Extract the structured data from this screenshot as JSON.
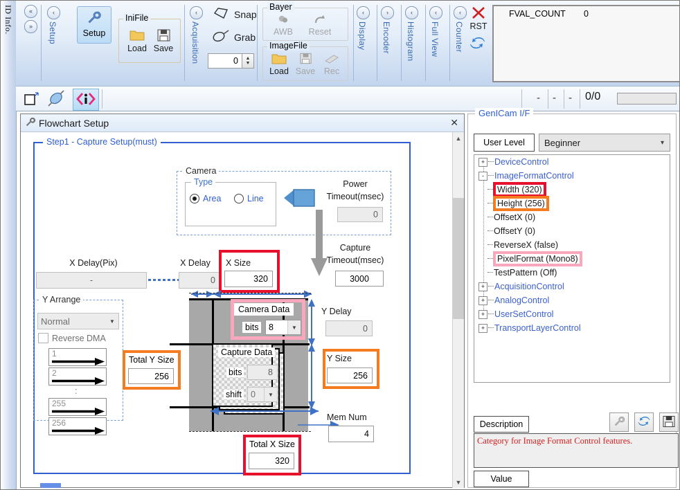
{
  "left_strip": {
    "label": "ID Info."
  },
  "ribbon": {
    "collapse_up": "«",
    "collapse_down": "»",
    "groups": [
      {
        "name": "Setup",
        "vlabel": "Setup",
        "arrow": "‹"
      },
      {
        "name": "Acquisition",
        "vlabel": "Acquisition",
        "arrow": "‹"
      },
      {
        "name": "Display",
        "vlabel": "Display",
        "arrow": "‹"
      },
      {
        "name": "Encoder",
        "vlabel": "Encoder",
        "arrow": "›"
      },
      {
        "name": "Histogram",
        "vlabel": "Histogram",
        "arrow": "‹"
      },
      {
        "name": "FullView",
        "vlabel": "Full View",
        "arrow": "‹"
      },
      {
        "name": "Counter",
        "vlabel": "Counter",
        "arrow": "‹"
      }
    ],
    "setup": {
      "main_button": "Setup",
      "inifile_title": "IniFile",
      "load": "Load",
      "save": "Save"
    },
    "acquisition": {
      "snap": "Snap",
      "grab": "Grab",
      "spin_value": "0"
    },
    "bayer": {
      "title": "Bayer",
      "awb": "AWB",
      "reset": "Reset"
    },
    "imagefile": {
      "title": "ImageFile",
      "load": "Load",
      "save": "Save",
      "rec": "Rec"
    },
    "counter_actions": {
      "rst": "RST"
    },
    "fval_panel": {
      "key": "FVAL_COUNT",
      "value": "0"
    }
  },
  "toolbar2": {
    "dash1": "-",
    "dash2": "-",
    "dash3": "-",
    "fraction": "0/0"
  },
  "flowchart": {
    "title": "Flowchart Setup",
    "close": "✕",
    "step_legend": "Step1 - Capture Setup(must)",
    "camera": {
      "legend": "Camera",
      "type_legend": "Type",
      "area": "Area",
      "line": "Line",
      "area_selected": true,
      "power_timeout_label_l1": "Power",
      "power_timeout_label_l2": "Timeout(msec)",
      "power_timeout_value": "0"
    },
    "capture_timeout_label_l1": "Capture",
    "capture_timeout_label_l2": "Timeout(msec)",
    "capture_timeout_value": "3000",
    "x_delay_pix_label": "X Delay(Pix)",
    "x_delay_pix_value": "-",
    "x_delay_label": "X Delay",
    "x_delay_value": "0",
    "x_size_label": "X Size",
    "x_size_value": "320",
    "y_arrange": {
      "legend": "Y Arrange",
      "mode": "Normal",
      "reverse_dma": "Reverse DMA",
      "reverse_dma_checked": false,
      "rows": [
        "1",
        "2",
        ":",
        "255",
        "256"
      ]
    },
    "total_y_size_label": "Total Y Size",
    "total_y_size_value": "256",
    "camera_data_label": "Camera Data",
    "camera_data_bits_label": "bits",
    "camera_data_bits_value": "8",
    "capture_data_label": "Capture Data",
    "capture_data_bits_label": "bits",
    "capture_data_bits_value": "8",
    "capture_data_shift_label": "shift",
    "capture_data_shift_value": "0",
    "y_delay_label": "Y Delay",
    "y_delay_value": "0",
    "y_size_label": "Y Size",
    "y_size_value": "256",
    "mem_num_label": "Mem Num",
    "mem_num_value": "4",
    "total_x_size_label": "Total X Size",
    "total_x_size_value": "320"
  },
  "genicam": {
    "legend": "GenICam I/F",
    "user_level_label": "User Level",
    "user_level_value": "Beginner",
    "tree": [
      {
        "label": "DeviceControl",
        "type": "category",
        "expander": "+",
        "depth": 0,
        "highlight": "none"
      },
      {
        "label": "ImageFormatControl",
        "type": "category",
        "expander": "-",
        "depth": 0,
        "highlight": "none"
      },
      {
        "label": "Width (320)",
        "type": "leaf",
        "expander": "",
        "depth": 1,
        "highlight": "red"
      },
      {
        "label": "Height (256)",
        "type": "leaf",
        "expander": "",
        "depth": 1,
        "highlight": "orange"
      },
      {
        "label": "OffsetX (0)",
        "type": "leaf",
        "expander": "",
        "depth": 1,
        "highlight": "none"
      },
      {
        "label": "OffsetY (0)",
        "type": "leaf",
        "expander": "",
        "depth": 1,
        "highlight": "none"
      },
      {
        "label": "ReverseX (false)",
        "type": "leaf",
        "expander": "",
        "depth": 1,
        "highlight": "none"
      },
      {
        "label": "PixelFormat (Mono8)",
        "type": "leaf",
        "expander": "",
        "depth": 1,
        "highlight": "pink"
      },
      {
        "label": "TestPattern (Off)",
        "type": "leaf",
        "expander": "",
        "depth": 1,
        "highlight": "none"
      },
      {
        "label": "AcquisitionControl",
        "type": "category",
        "expander": "+",
        "depth": 0,
        "highlight": "none"
      },
      {
        "label": "AnalogControl",
        "type": "category",
        "expander": "+",
        "depth": 0,
        "highlight": "none"
      },
      {
        "label": "UserSetControl",
        "type": "category",
        "expander": "+",
        "depth": 0,
        "highlight": "none"
      },
      {
        "label": "TransportLayerControl",
        "type": "category",
        "expander": "+",
        "depth": 0,
        "highlight": "none"
      }
    ],
    "description_label": "Description",
    "description_text": "Category for Image Format Control features.",
    "value_label": "Value"
  },
  "colors": {
    "highlight_red": "#e8112d",
    "highlight_orange": "#f47b20",
    "highlight_pink": "#f9a7bd",
    "accent_blue": "#2f5fd0",
    "link_blue": "#3b5fd0",
    "description_red": "#cf1f1f"
  }
}
